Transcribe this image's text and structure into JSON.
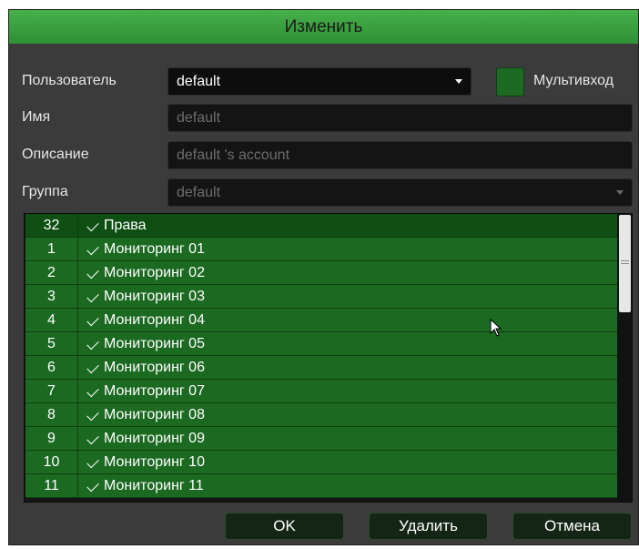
{
  "dialog": {
    "title": "Изменить"
  },
  "form": {
    "user_label": "Пользователь",
    "user_value": "default",
    "multi_label": "Мультивход",
    "name_label": "Имя",
    "name_value": "default",
    "desc_label": "Описание",
    "desc_value": "default 's account",
    "group_label": "Группа",
    "group_value": "default"
  },
  "permissions": {
    "header": {
      "count": "32",
      "label": "Права"
    },
    "rows": [
      {
        "num": "1",
        "label": "Мониторинг 01"
      },
      {
        "num": "2",
        "label": "Мониторинг 02"
      },
      {
        "num": "3",
        "label": "Мониторинг 03"
      },
      {
        "num": "4",
        "label": "Мониторинг 04"
      },
      {
        "num": "5",
        "label": "Мониторинг 05"
      },
      {
        "num": "6",
        "label": "Мониторинг 06"
      },
      {
        "num": "7",
        "label": "Мониторинг 07"
      },
      {
        "num": "8",
        "label": "Мониторинг 08"
      },
      {
        "num": "9",
        "label": "Мониторинг 09"
      },
      {
        "num": "10",
        "label": "Мониторинг 10"
      },
      {
        "num": "11",
        "label": "Мониторинг 11"
      }
    ]
  },
  "buttons": {
    "ok": "OK",
    "delete": "Удалить",
    "cancel": "Отмена"
  },
  "icons": {
    "checkbox": "check-icon",
    "dropdown": "chevron-down-icon",
    "cursor": "mouse-pointer-icon"
  },
  "colors": {
    "title_green": "#3fa843",
    "row_green": "#1c6a22",
    "dialog_bg": "#3b3b3b"
  }
}
